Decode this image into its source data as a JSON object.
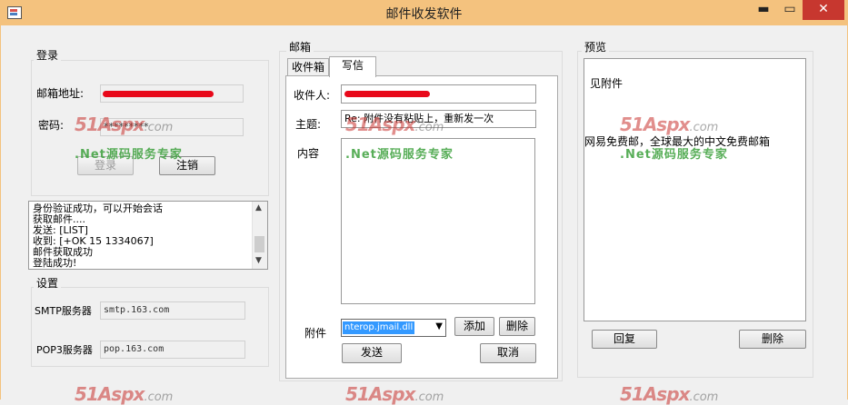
{
  "window": {
    "title": "邮件收发软件",
    "minimize": "▬",
    "maximize": "▭",
    "close": "✕",
    "title_color": "#f4c27e",
    "close_color": "#c7372f"
  },
  "login": {
    "group_label": "登录",
    "email_label": "邮箱地址:",
    "password_label": "密码:",
    "password_value": "*********",
    "login_button": "登录",
    "logout_button": "注销"
  },
  "log": {
    "lines": "身份验证成功，可以开始会话\n获取邮件....\n发送: [LIST]\n收到: [+OK 15 1334067]\n邮件获取成功\n登陆成功!"
  },
  "settings": {
    "group_label": "设置",
    "smtp_label": "SMTP服务器",
    "smtp_value": "smtp.163.com",
    "pop3_label": "POP3服务器",
    "pop3_value": "pop.163.com"
  },
  "mailbox": {
    "group_label": "邮箱",
    "tabs": [
      {
        "label": "收件箱",
        "active": false
      },
      {
        "label": "写信",
        "active": true
      }
    ],
    "recipient_label": "收件人:",
    "subject_label": "主题:",
    "subject_value": "Re: 附件没有粘贴上，重新发一次",
    "content_label": "内容",
    "attachment_label": "附件",
    "attachment_value": "nterop.jmail.dll",
    "add_button": "添加",
    "delete_button": "删除",
    "send_button": "发送",
    "cancel_button": "取消"
  },
  "preview": {
    "group_label": "预览",
    "line1": "见附件",
    "line2": "网易免费邮，全球最大的中文免费邮箱",
    "reply_button": "回复",
    "delete_button": "删除"
  },
  "watermark": {
    "brand": "51Aspx",
    "domain": ".com",
    "slogan": ".Net源码服务专家"
  }
}
